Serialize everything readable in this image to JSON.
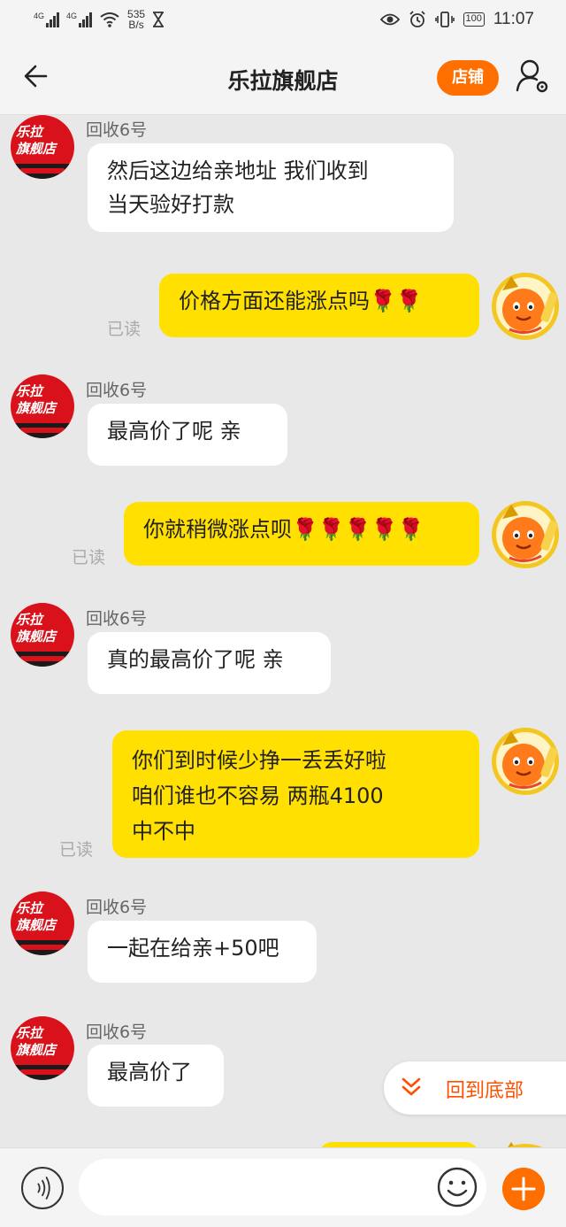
{
  "status_bar": {
    "net1": "4G",
    "net2": "4G",
    "speed_value": "535",
    "speed_unit": "B/s",
    "battery": "100",
    "time": "11:07"
  },
  "header": {
    "title": "乐拉旗舰店",
    "shop_button": "店铺"
  },
  "shop_avatar_text": [
    "乐拉",
    "旗舰店"
  ],
  "messages": [
    {
      "side": "in",
      "sender": "回收6号",
      "lines": [
        "然后这边给亲地址  我们收到",
        "当天验好打款"
      ]
    },
    {
      "side": "out",
      "status": "已读",
      "lines": [
        "价格方面还能涨点吗🌹🌹"
      ]
    },
    {
      "side": "in",
      "sender": "回收6号",
      "lines": [
        "最高价了呢  亲"
      ]
    },
    {
      "side": "out",
      "status": "已读",
      "lines": [
        "你就稍微涨点呗🌹🌹🌹🌹🌹"
      ]
    },
    {
      "side": "in",
      "sender": "回收6号",
      "lines": [
        "真的最高价了呢 亲"
      ]
    },
    {
      "side": "out",
      "status": "已读",
      "lines": [
        "你们到时候少挣一丢丢好啦",
        "咱们谁也不容易    两瓶4100",
        "中不中"
      ]
    },
    {
      "side": "in",
      "sender": "回收6号",
      "lines": [
        "一起在给亲+50吧"
      ]
    },
    {
      "side": "in",
      "sender": "回收6号",
      "lines": [
        "最高价了"
      ]
    }
  ],
  "scroll_to_bottom": {
    "label": "回到底部"
  },
  "input": {
    "value": "",
    "placeholder": ""
  },
  "colors": {
    "accent": "#ff6f00",
    "outgoing_bubble": "#ffe000",
    "incoming_bubble": "#ffffff",
    "background": "#e8e8e8"
  },
  "icons": {
    "back": "arrow-left-icon",
    "profile": "user-settings-icon",
    "voice": "voice-icon",
    "emoji": "smiley-icon",
    "plus": "plus-icon",
    "to_bottom": "double-chevron-down-icon"
  }
}
